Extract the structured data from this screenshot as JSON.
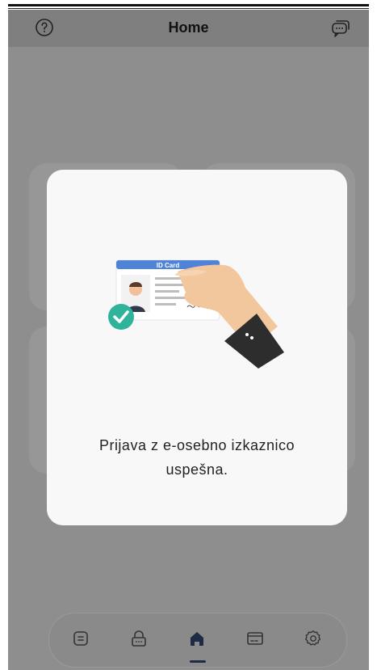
{
  "header": {
    "title": "Home",
    "help_icon": "question-circle-icon",
    "chat_icon": "chat-bubbles-icon"
  },
  "modal": {
    "illustration_card_label": "ID Card",
    "message_line1": "Prijava z e-osebno izkaznico",
    "message_line2": "uspešna."
  },
  "nav": {
    "items": [
      {
        "icon": "document-icon",
        "active": false
      },
      {
        "icon": "lock-icon",
        "active": false
      },
      {
        "icon": "home-icon",
        "active": true
      },
      {
        "icon": "card-icon",
        "active": false
      },
      {
        "icon": "settings-icon",
        "active": false
      }
    ]
  },
  "colors": {
    "active_nav": "#1f2a44",
    "check_green": "#2fb39b",
    "card_header_blue": "#4f83d8"
  }
}
